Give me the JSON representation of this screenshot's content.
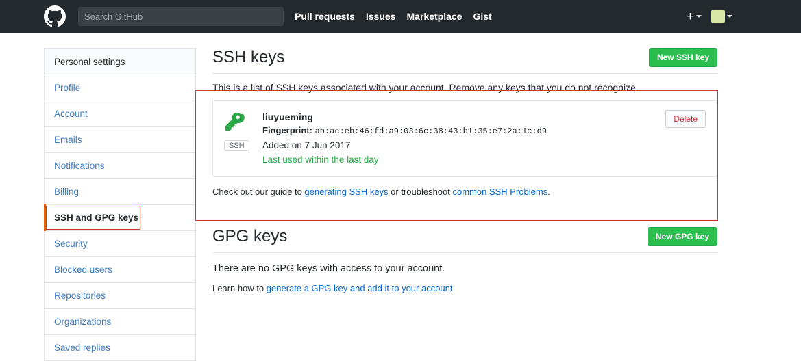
{
  "header": {
    "logo_icon": "github-mark-icon",
    "search": {
      "placeholder": "Search GitHub",
      "value": ""
    },
    "nav": [
      {
        "label": "Pull requests"
      },
      {
        "label": "Issues"
      },
      {
        "label": "Marketplace"
      },
      {
        "label": "Gist"
      }
    ],
    "create_new_icon": "plus-icon",
    "account_icon": "avatar"
  },
  "sidebar": {
    "heading": "Personal settings",
    "items": [
      {
        "label": "Profile",
        "selected": false
      },
      {
        "label": "Account",
        "selected": false
      },
      {
        "label": "Emails",
        "selected": false
      },
      {
        "label": "Notifications",
        "selected": false
      },
      {
        "label": "Billing",
        "selected": false
      },
      {
        "label": "SSH and GPG keys",
        "selected": true
      },
      {
        "label": "Security",
        "selected": false
      },
      {
        "label": "Blocked users",
        "selected": false
      },
      {
        "label": "Repositories",
        "selected": false
      },
      {
        "label": "Organizations",
        "selected": false
      },
      {
        "label": "Saved replies",
        "selected": false
      }
    ]
  },
  "ssh_section": {
    "title": "SSH keys",
    "new_button": "New SSH key",
    "description": "This is a list of SSH keys associated with your account. Remove any keys that you do not recognize.",
    "key": {
      "icon": "key-icon",
      "type_badge": "SSH",
      "name": "liuyueming",
      "fingerprint_label": "Fingerprint:",
      "fingerprint": "ab:ac:eb:46:fd:a9:03:6c:38:43:b1:35:e7:2a:1c:d9",
      "added": "Added on 7 Jun 2017",
      "last_used": "Last used within the last day",
      "delete_button": "Delete"
    },
    "footer": {
      "prefix": "Check out our guide to ",
      "link1": "generating SSH keys",
      "middle": " or troubleshoot ",
      "link2": "common SSH Problems",
      "suffix": "."
    }
  },
  "gpg_section": {
    "title": "GPG keys",
    "new_button": "New GPG key",
    "empty_message": "There are no GPG keys with access to your account.",
    "learn_prefix": "Learn how to ",
    "learn_link": "generate a GPG key and add it to your account",
    "learn_suffix": "."
  },
  "colors": {
    "header_bg": "#24292e",
    "green_button": "#2cbe4e",
    "link_blue": "#0366d6",
    "success_green": "#28a745",
    "delete_red": "#cb2431",
    "annotation_red": "#d0342c",
    "active_marker": "#e36209"
  }
}
